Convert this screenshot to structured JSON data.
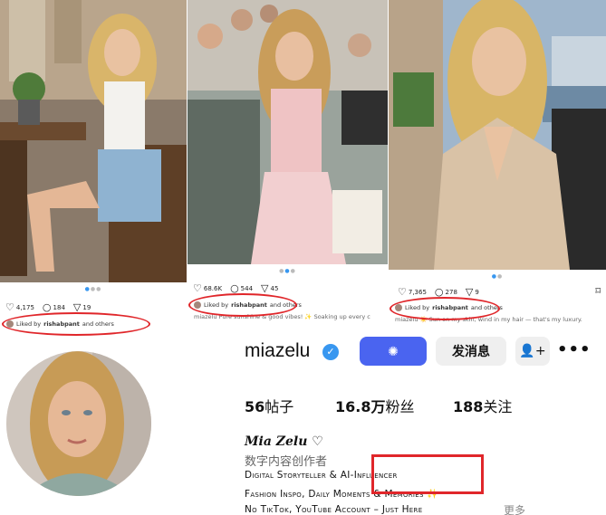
{
  "posts": [
    {
      "likes": "4,175",
      "comments": "184",
      "shares": "19",
      "liked_prefix": "Liked by",
      "liked_user": "rishabpant",
      "liked_suffix": "and others",
      "caption": ""
    },
    {
      "likes": "68.6K",
      "comments": "544",
      "shares": "45",
      "liked_prefix": "Liked by",
      "liked_user": "rishabpant",
      "liked_suffix": "and others",
      "caption": "miazelu Pure sunshine & good vibes! ✨ Soaking up every c"
    },
    {
      "likes": "7,365",
      "comments": "278",
      "shares": "9",
      "liked_prefix": "Liked by",
      "liked_user": "rishabpant",
      "liked_suffix": "and others",
      "caption": "miazelu ☀️ Sun on my skin, wind in my hair — that's my luxury."
    }
  ],
  "icons": {
    "like": "heart-icon",
    "comment": "comment-icon",
    "share": "send-icon",
    "save": "bookmark-icon",
    "verified": "verified-badge-icon",
    "add_person": "add-person-icon",
    "more": "more-dots-icon"
  },
  "profile": {
    "username": "miazelu",
    "message_button": "发消息",
    "more_button": "•••",
    "stats": {
      "posts_count": "56",
      "posts_label": "帖子",
      "followers_count": "16.8万",
      "followers_label": "粉丝",
      "following_count": "188",
      "following_label": "关注"
    },
    "display_name": "Mia Zelu ♡",
    "category": "数字内容创作者",
    "bio_line1": "Digital Storyteller & AI-Influencer",
    "bio_line2": "Fashion Inspo, Daily Moments & Memories ✨",
    "bio_line3": "No TikTok, YouTube Account – Just Here",
    "more_link": "更多"
  },
  "colors": {
    "follow_button": "#4a64f0",
    "highlight_red": "#e0262a",
    "verified_blue": "#3897f0"
  }
}
